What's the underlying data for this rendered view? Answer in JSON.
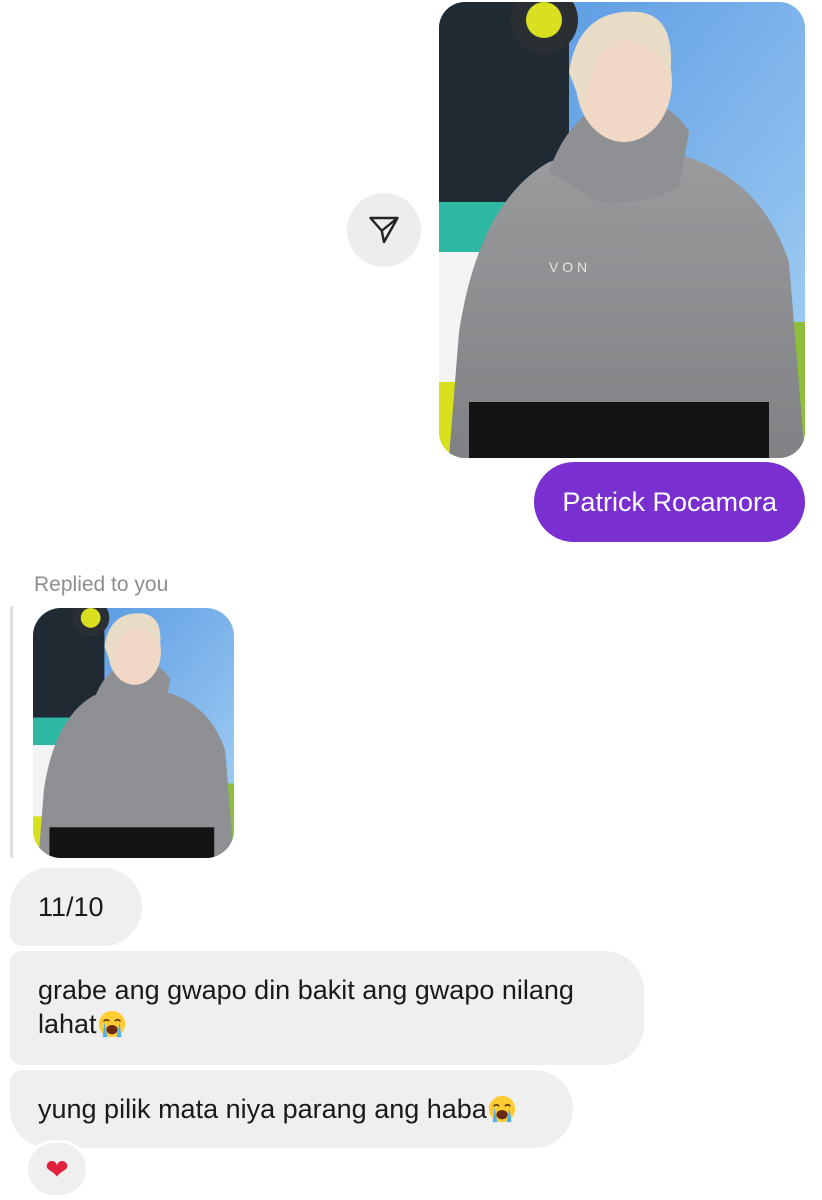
{
  "sent": {
    "photo_alt": "Photo",
    "caption": "Patrick Rocamora"
  },
  "reply": {
    "label": "Replied to you"
  },
  "messages": [
    {
      "text": "11/10",
      "emoji": ""
    },
    {
      "text": "grabe ang gwapo din bakit ang gwapo nilang lahat",
      "emoji": "loudly-crying-face"
    },
    {
      "text": "yung pilik mata niya parang ang haba",
      "emoji": "loudly-crying-face"
    }
  ],
  "reaction": {
    "glyph": "❤"
  },
  "colors": {
    "sent_bubble": "#7a2fd1",
    "received_bubble": "#efefef",
    "muted_text": "#8e8e8e"
  }
}
